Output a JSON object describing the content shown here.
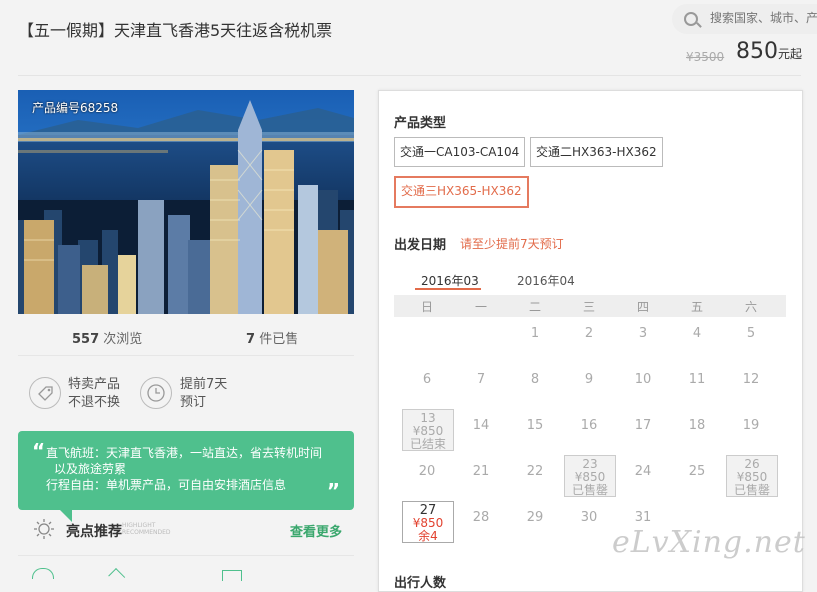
{
  "header": {
    "title": "【五一假期】天津直飞香港5天往返含税机票",
    "search_placeholder": "搜索国家、城市、产",
    "old_price": "¥3500",
    "price": "850",
    "price_suffix": "元起"
  },
  "product": {
    "code": "产品编号68258",
    "views_count": "557",
    "views_label": "次浏览",
    "sold_count": "7",
    "sold_label": "件已售"
  },
  "features": [
    {
      "line1": "特卖产品",
      "line2": "不退不换",
      "icon": "tag-icon"
    },
    {
      "line1": "提前7天",
      "line2": "预订",
      "icon": "clock-icon"
    }
  ],
  "promo": {
    "lines": [
      "直飞航班：天津直飞香港，一站直达，省去转机时间",
      "以及旅途劳累",
      "行程自由：单机票产品，可自由安排酒店信息"
    ]
  },
  "recommend": {
    "label": "亮点推荐",
    "label_en1": "HIGHLIGHT",
    "label_en2": "RECOMMENDED",
    "more": "查看更多"
  },
  "booking": {
    "product_type_label": "产品类型",
    "options": [
      "交通一CA103-CA104",
      "交通二HX363-HX362",
      "交通三HX365-HX362"
    ],
    "selected_option": 2,
    "date_label": "出发日期",
    "date_tip": "请至少提前7天预订",
    "months": [
      "2016年03",
      "2016年04"
    ],
    "weekdays": [
      "日",
      "一",
      "二",
      "三",
      "四",
      "五",
      "六"
    ],
    "rows": [
      [
        "",
        "",
        "1",
        "2",
        "3",
        "4",
        "5"
      ],
      [
        "6",
        "7",
        "8",
        "9",
        "10",
        "11",
        "12"
      ],
      [
        "13",
        "14",
        "15",
        "16",
        "17",
        "18",
        "19"
      ],
      [
        "20",
        "21",
        "22",
        "23",
        "24",
        "25",
        "26"
      ],
      [
        "27",
        "28",
        "29",
        "30",
        "31",
        "",
        ""
      ]
    ],
    "special": {
      "13": {
        "price": "¥850",
        "status": "已结束"
      },
      "23": {
        "price": "¥850",
        "status": "已售罄"
      },
      "26": {
        "price": "¥850",
        "status": "已售罄"
      },
      "27": {
        "price": "¥850",
        "status": "余4"
      }
    },
    "next_section_label": "出行人数"
  },
  "watermark": "eLvXing.net",
  "colors": {
    "accent": "#e26b4a",
    "green": "#4fc08d",
    "link_green": "#3aa76d"
  }
}
